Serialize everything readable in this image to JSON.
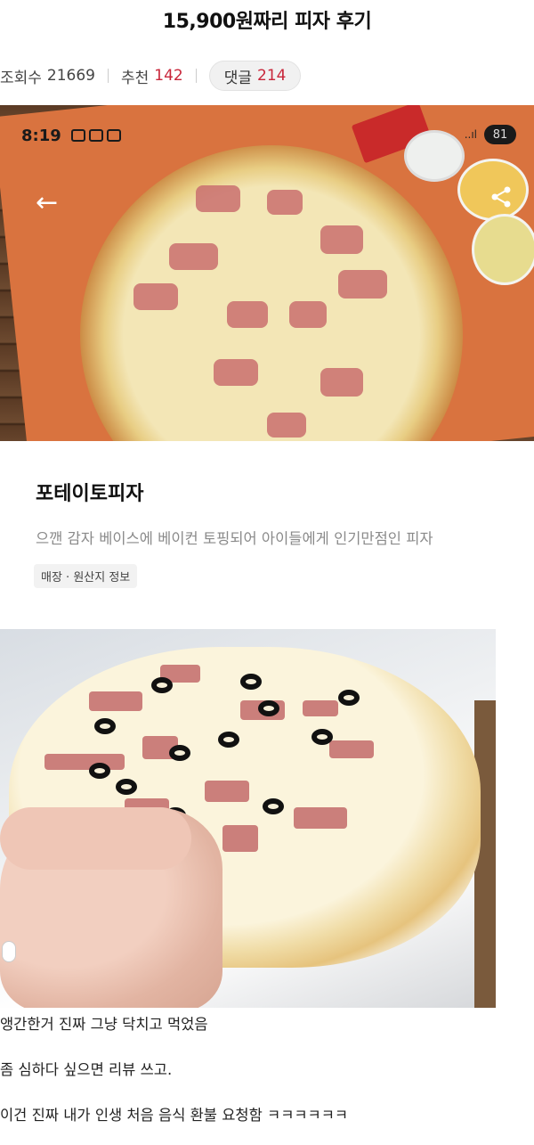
{
  "post": {
    "title": "15,900원짜리 피자 후기"
  },
  "stats": {
    "views_label": "조회수",
    "views_count": "21669",
    "recommend_label": "추천",
    "recommend_count": "142",
    "comments_label": "댓글",
    "comments_count": "214"
  },
  "photo1": {
    "status_time": "8:19",
    "battery": "81",
    "signal": "..ıl"
  },
  "product": {
    "name": "포테이토피자",
    "description": "으깬 감자 베이스에 베이컨 토핑되어 아이들에게 인기만점인 피자",
    "info_chip": "매장 · 원산지 정보"
  },
  "comments": [
    "앵간한거 진짜 그냥 닥치고 먹었음",
    "좀 심하다 싶으면 리뷰 쓰고.",
    "이건 진짜 내가 인생 처음 음식 환불 요청함 ㅋㅋㅋㅋㅋㅋ"
  ],
  "colors": {
    "accent_red": "#c8263a",
    "muted_text": "#8a8a8a",
    "board": "#d9733f"
  },
  "icons": [
    "back-arrow-icon",
    "share-icon",
    "battery-icon",
    "signal-icon"
  ]
}
